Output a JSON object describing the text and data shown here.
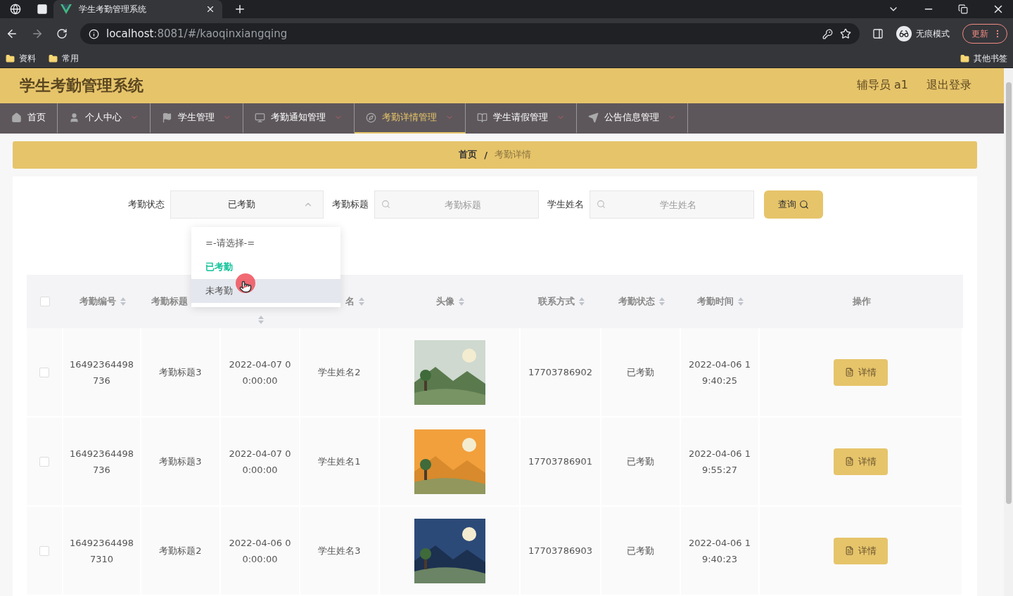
{
  "browser": {
    "tabs": [
      {
        "title": "学生考勤管理系统",
        "selected": true
      }
    ],
    "address": {
      "host": "localhost",
      "path": ":8081/#/kaoqinxiangqing"
    },
    "profile": "无痕模式",
    "update": "更新",
    "bookmarks": [
      "资料",
      "常用"
    ],
    "other_bookmarks": "其他书签"
  },
  "header": {
    "title": "学生考勤管理系统",
    "user": "辅导员 a1",
    "logout": "退出登录"
  },
  "nav": [
    {
      "label": "首页",
      "kind": "home",
      "selected": false,
      "has_menu": false
    },
    {
      "label": "个人中心",
      "kind": "user",
      "selected": false,
      "has_menu": true
    },
    {
      "label": "学生管理",
      "kind": "flag",
      "selected": false,
      "has_menu": true
    },
    {
      "label": "考勤通知管理",
      "kind": "monitor",
      "selected": false,
      "has_menu": true
    },
    {
      "label": "考勤详情管理",
      "kind": "compass",
      "selected": true,
      "has_menu": true
    },
    {
      "label": "学生请假管理",
      "kind": "book",
      "selected": false,
      "has_menu": true
    },
    {
      "label": "公告信息管理",
      "kind": "plane",
      "selected": false,
      "has_menu": true
    }
  ],
  "breadcrumb": {
    "items": [
      "首页",
      "考勤详情"
    ],
    "separator": "/"
  },
  "filters": {
    "status": {
      "label": "考勤状态",
      "value": "已考勤",
      "expanded": true,
      "options": [
        {
          "label": "=-请选择-=",
          "selected": false,
          "hovered": false
        },
        {
          "label": "已考勤",
          "selected": true,
          "hovered": false
        },
        {
          "label": "未考勤",
          "selected": false,
          "hovered": true
        }
      ]
    },
    "title": {
      "label": "考勤标题",
      "placeholder": "考勤标题"
    },
    "name": {
      "label": "学生姓名",
      "placeholder": "学生姓名"
    },
    "search_button": "查询"
  },
  "table": {
    "all_checked": false,
    "columns": [
      {
        "label": "考勤编号",
        "sortable": true
      },
      {
        "label": "考勤标题",
        "sortable": false
      },
      {
        "sortable": true
      },
      {
        "label": "名",
        "sortable": true
      },
      {
        "label": "头像",
        "sortable": true
      },
      {
        "label": "联系方式",
        "sortable": true
      },
      {
        "label": "考勤状态",
        "sortable": true
      },
      {
        "label": "考勤时间",
        "sortable": true
      },
      {
        "label": "操作",
        "sortable": false
      }
    ],
    "rows": [
      {
        "checked": false,
        "id": "16492364498736",
        "title": "考勤标题3",
        "date": "2022-04-07 00:00:00",
        "name": "学生姓名2",
        "phone": "17703786902",
        "status": "已考勤",
        "time": "2022-04-06 19:40:25",
        "action": "详情"
      },
      {
        "checked": false,
        "id": "16492364498736",
        "title": "考勤标题3",
        "date": "2022-04-07 00:00:00",
        "name": "学生姓名1",
        "phone": "17703786901",
        "status": "已考勤",
        "time": "2022-04-06 19:55:27",
        "action": "详情"
      },
      {
        "checked": false,
        "id": "164923644987310",
        "title": "考勤标题2",
        "date": "2022-04-06 00:00:00",
        "name": "学生姓名3",
        "phone": "17703786903",
        "status": "已考勤",
        "time": "2022-04-06 19:40:23",
        "action": "详情"
      }
    ]
  }
}
